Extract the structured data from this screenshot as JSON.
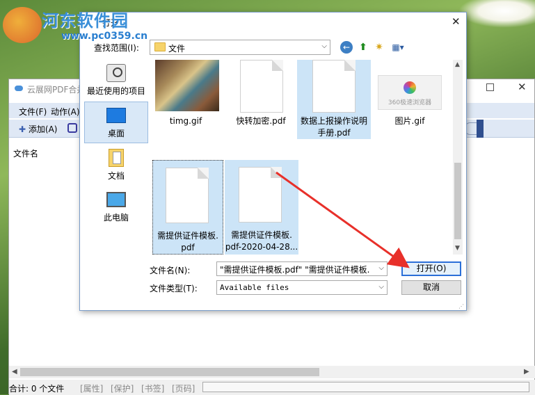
{
  "watermark": {
    "title": "河东软件园",
    "url": "www.pc0359.cn"
  },
  "app": {
    "title": "云展网PDF合并",
    "menu": [
      "文件(F)",
      "动作(A)"
    ],
    "toolbar": {
      "add_label": "添加(A)"
    },
    "column_header": "文件名",
    "status": {
      "count": "合计: 0 个文件",
      "buttons": [
        "[属性]",
        "[保护]",
        "[书签]",
        "[页码]"
      ]
    }
  },
  "dialog": {
    "title": "打开",
    "look_in_label": "查找范围(I):",
    "look_in_value": "文件",
    "places": [
      {
        "label": "最近使用的项目",
        "icon": "recent-items-icon"
      },
      {
        "label": "桌面",
        "icon": "desktop-icon"
      },
      {
        "label": "文档",
        "icon": "documents-icon"
      },
      {
        "label": "此电脑",
        "icon": "this-pc-icon"
      }
    ],
    "files": [
      {
        "name": "timg.gif",
        "type": "image-thumbnail"
      },
      {
        "name": "快转加密.pdf",
        "type": "document"
      },
      {
        "name": "数据上报操作说明手册.pdf",
        "type": "document",
        "line1": "数据上报操作说明",
        "line2": "手册.pdf"
      },
      {
        "name": "图片.gif",
        "type": "browser-thumbnail",
        "thumb_caption": "360极速浏览器"
      },
      {
        "name": "需提供证件模板.pdf",
        "type": "document",
        "line1": "需提供证件模板.",
        "line2": "pdf"
      },
      {
        "name": "需提供证件模板.pdf-2020-04-28...",
        "type": "document",
        "line1": "需提供证件模板.",
        "line2": "pdf-2020-04-28..."
      }
    ],
    "file_name_label": "文件名(N):",
    "file_name_value": "\"需提供证件模板.pdf\" \"需提供证件模板.",
    "file_type_label": "文件类型(T):",
    "file_type_value": "Available files",
    "open_button": "打开(O)",
    "cancel_button": "取消"
  },
  "colors": {
    "accent": "#2a6fd8",
    "selection": "#cce4f7",
    "arrow": "#e8302a"
  }
}
